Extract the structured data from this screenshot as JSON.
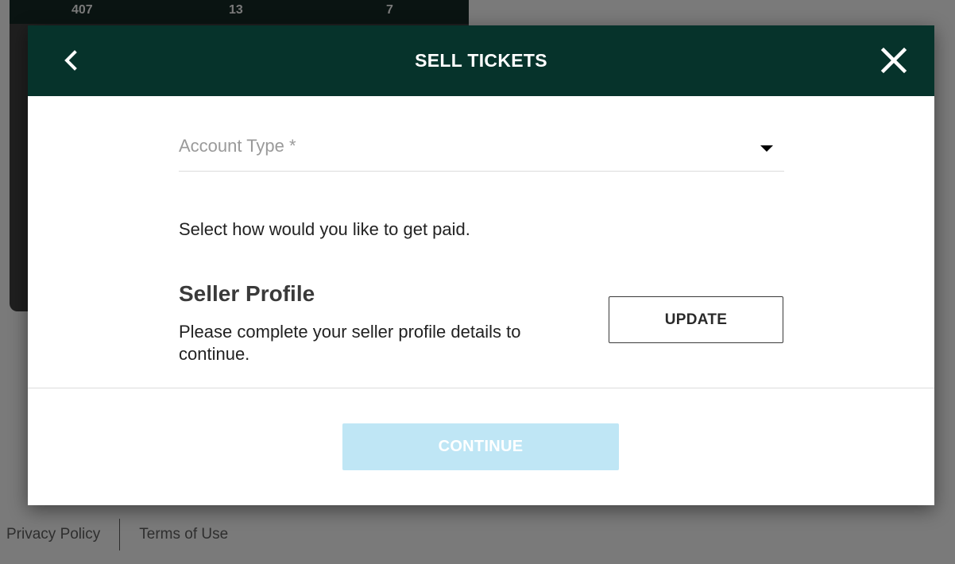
{
  "background": {
    "stats": [
      "407",
      "13",
      "7"
    ],
    "footer": {
      "privacy_label": "Privacy Policy",
      "terms_label": "Terms of Use"
    }
  },
  "modal": {
    "title": "SELL TICKETS",
    "back_icon": "chevron-left-icon",
    "close_icon": "close-icon",
    "header_color": "#06332b",
    "account_type": {
      "label": "Account Type *",
      "value": "",
      "helper": "Select how would you like to get paid."
    },
    "seller_profile": {
      "heading": "Seller Profile",
      "description": "Please complete your seller profile details to continue.",
      "update_label": "UPDATE"
    },
    "continue_label": "CONTINUE",
    "continue_color": "#bfe6f5"
  }
}
